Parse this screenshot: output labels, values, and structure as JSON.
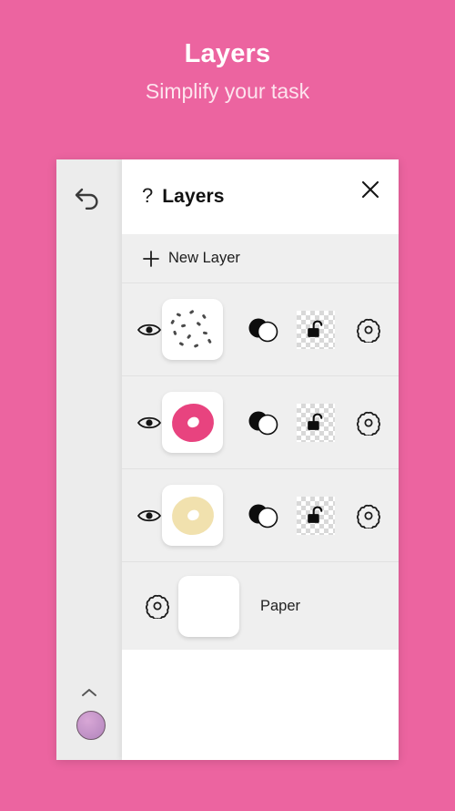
{
  "promo": {
    "title": "Layers",
    "subtitle": "Simplify your task",
    "background_color": "#ec64a0",
    "title_color": "#ffffff",
    "subtitle_color": "#fde4ee"
  },
  "rail": {
    "undo_icon": "undo-arrow-icon",
    "chevron_icon": "chevron-up-icon",
    "color_swatch": "#bd8fc4"
  },
  "canvas": {
    "artwork_name": "pink-donut-artwork",
    "glaze_color": "#e98ab4",
    "dough_color": "#f6dfc0",
    "sprinkle_colors": [
      "#fbd2de",
      "#f7c7d9",
      "#8c2142"
    ]
  },
  "panel": {
    "help_icon": "?",
    "title": "Layers",
    "close_icon": "close-icon",
    "new_layer": {
      "label": "New Layer",
      "plus_icon": "plus-icon"
    },
    "layers": [
      {
        "name": "sprinkles-layer",
        "visible": true,
        "visibility_icon": "eye-icon",
        "thumbnail_type": "sprinkles",
        "blend_icon": "blend-mode-icon",
        "lock_icon": "unlock-icon",
        "locked": false,
        "settings_icon": "gear-icon"
      },
      {
        "name": "pink-glaze-layer",
        "visible": true,
        "visibility_icon": "eye-icon",
        "thumbnail_type": "donut-pink",
        "thumbnail_color": "#e8437f",
        "blend_icon": "blend-mode-icon",
        "lock_icon": "unlock-icon",
        "locked": false,
        "settings_icon": "gear-icon"
      },
      {
        "name": "dough-layer",
        "visible": true,
        "visibility_icon": "eye-icon",
        "thumbnail_type": "donut-cream",
        "thumbnail_color": "#f1e1ae",
        "blend_icon": "blend-mode-icon",
        "lock_icon": "unlock-icon",
        "locked": false,
        "settings_icon": "gear-icon"
      }
    ],
    "paper": {
      "label": "Paper",
      "settings_icon": "gear-icon",
      "thumbnail_color": "#ffffff"
    }
  }
}
